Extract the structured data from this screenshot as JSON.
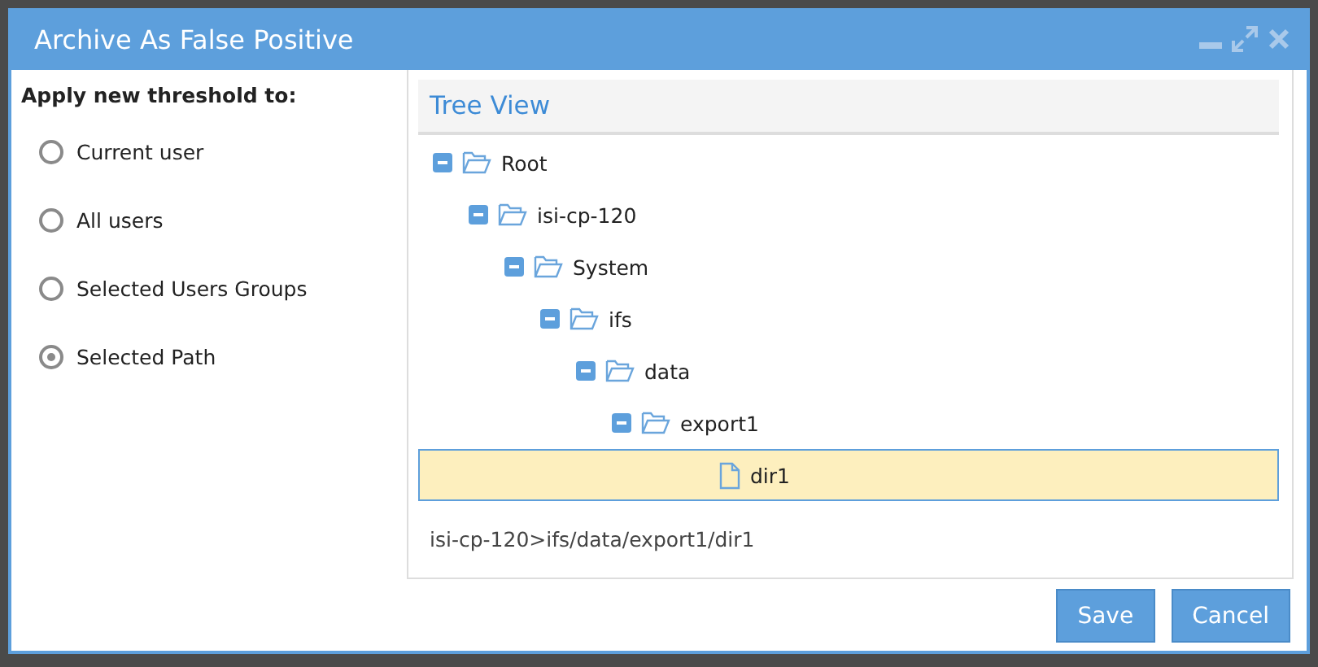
{
  "dialog": {
    "title": "Archive As False Positive"
  },
  "threshold": {
    "heading": "Apply new threshold to:",
    "options": [
      {
        "label": "Current user",
        "selected": false
      },
      {
        "label": "All users",
        "selected": false
      },
      {
        "label": "Selected Users Groups",
        "selected": false
      },
      {
        "label": "Selected Path",
        "selected": true
      }
    ]
  },
  "tree_view": {
    "title": "Tree View",
    "nodes": [
      {
        "label": "Root",
        "kind": "folder",
        "expanded": true,
        "selected": false,
        "children": [
          {
            "label": "isi-cp-120",
            "kind": "folder",
            "expanded": true,
            "selected": false,
            "children": [
              {
                "label": "System",
                "kind": "folder",
                "expanded": true,
                "selected": false,
                "children": [
                  {
                    "label": "ifs",
                    "kind": "folder",
                    "expanded": true,
                    "selected": false,
                    "children": [
                      {
                        "label": "data",
                        "kind": "folder",
                        "expanded": true,
                        "selected": false,
                        "children": [
                          {
                            "label": "export1",
                            "kind": "folder",
                            "expanded": true,
                            "selected": false,
                            "children": [
                              {
                                "label": "dir1",
                                "kind": "file",
                                "selected": true
                              }
                            ]
                          }
                        ]
                      }
                    ]
                  }
                ]
              }
            ]
          }
        ]
      }
    ],
    "path": "isi-cp-120>ifs/data/export1/dir1"
  },
  "buttons": [
    {
      "label": "Save"
    },
    {
      "label": "Cancel"
    }
  ]
}
